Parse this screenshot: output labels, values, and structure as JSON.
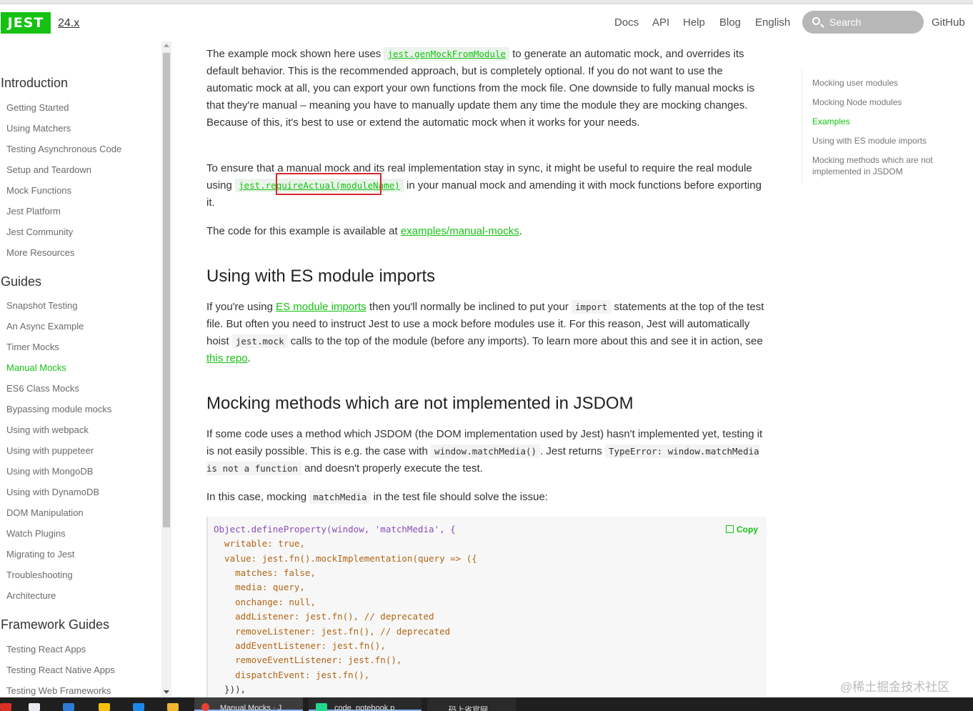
{
  "header": {
    "logo": "JEST",
    "version": "24.x",
    "nav": [
      "Docs",
      "API",
      "Help",
      "Blog",
      "English"
    ],
    "search_placeholder": "Search",
    "github": "GitHub"
  },
  "sidebar": {
    "categories": [
      {
        "title": "Introduction",
        "items": [
          "Getting Started",
          "Using Matchers",
          "Testing Asynchronous Code",
          "Setup and Teardown",
          "Mock Functions",
          "Jest Platform",
          "Jest Community",
          "More Resources"
        ]
      },
      {
        "title": "Guides",
        "items": [
          "Snapshot Testing",
          "An Async Example",
          "Timer Mocks",
          "Manual Mocks",
          "ES6 Class Mocks",
          "Bypassing module mocks",
          "Using with webpack",
          "Using with puppeteer",
          "Using with MongoDB",
          "Using with DynamoDB",
          "DOM Manipulation",
          "Watch Plugins",
          "Migrating to Jest",
          "Troubleshooting",
          "Architecture"
        ]
      },
      {
        "title": "Framework Guides",
        "items": [
          "Testing React Apps",
          "Testing React Native Apps",
          "Testing Web Frameworks"
        ]
      }
    ],
    "active_item": "Manual Mocks"
  },
  "main": {
    "p1_a": "The example mock shown here uses",
    "p1_code": "jest.genMockFromModule",
    "p1_b": "to generate an automatic mock, and overrides its default behavior. This is the recommended approach, but is completely optional. If you do not want to use the automatic mock at all, you can export your own functions from the mock file. One downside to fully manual mocks is that they're manual – meaning you have to manually update them any time the module they are mocking changes. Because of this, it's best to use or extend the automatic mock when it works for your needs.",
    "p2_a": "To ensure that a manual mock and its real implementation stay in sync, it might be useful to require the real module using",
    "p2_code": "jest.requireActual(moduleName)",
    "p2_b": "in your manual mock and amending it with mock functions before exporting it.",
    "p3_a": "The code for this example is available at",
    "p3_link": "examples/manual-mocks",
    "p3_b": ".",
    "h2_es": "Using with ES module imports",
    "p4_a": "If you're using",
    "p4_link1": "ES module imports",
    "p4_b": "then you'll normally be inclined to put your",
    "p4_code1": "import",
    "p4_c": "statements at the top of the test file. But often you need to instruct Jest to use a mock before modules use it. For this reason, Jest will automatically hoist",
    "p4_code2": "jest.mock",
    "p4_d": "calls to the top of the module (before any imports). To learn more about this and see it in action, see",
    "p4_link2": "this repo",
    "p4_e": ".",
    "h2_jsdom": "Mocking methods which are not implemented in JSDOM",
    "p5_a": "If some code uses a method which JSDOM (the DOM implementation used by Jest) hasn't implemented yet, testing it is not easily possible. This is e.g. the case with",
    "p5_code1": "window.matchMedia()",
    "p5_b": ". Jest returns",
    "p5_code2": "TypeError: window.matchMedia is not a function",
    "p5_c": "and doesn't properly execute the test.",
    "p6_a": "In this case, mocking",
    "p6_code": "matchMedia",
    "p6_b": "in the test file should solve the issue:",
    "copy_label": "Copy",
    "code_lines": [
      "Object.defineProperty(window, 'matchMedia', {",
      "  writable: true,",
      "  value: jest.fn().mockImplementation(query => ({",
      "    matches: false,",
      "    media: query,",
      "    onchange: null,",
      "    addListener: jest.fn(), // deprecated",
      "    removeListener: jest.fn(), // deprecated",
      "    addEventListener: jest.fn(),",
      "    removeEventListener: jest.fn(),",
      "    dispatchEvent: jest.fn(),",
      "  })),"
    ]
  },
  "toc": {
    "items": [
      "Mocking user modules",
      "Mocking Node modules",
      "Examples",
      "Using with ES module imports",
      "Mocking methods which are not implemented in JSDOM"
    ],
    "active": "Examples"
  },
  "watermark": "@稀土掘金技术社区",
  "taskbar": {
    "tasks": [
      "Manual Mocks · J",
      "code_notebook.p",
      "码上省官网"
    ]
  }
}
